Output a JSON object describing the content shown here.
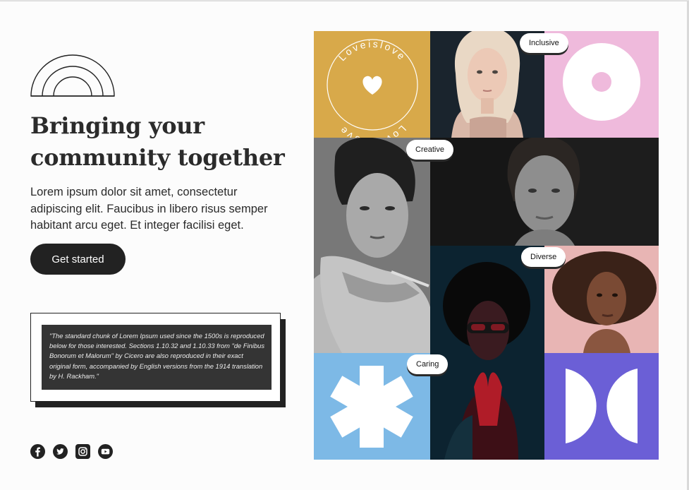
{
  "hero": {
    "headline_line1": "Bringing your",
    "headline_line2": "community together",
    "lead": "Lorem ipsum dolor sit amet, consectetur adipiscing elit. Faucibus in libero risus semper habitant arcu eget. Et integer facilisi eget.",
    "cta_label": "Get started"
  },
  "quote": {
    "text": "\"The standard chunk of Lorem Ipsum used since the 1500s is reproduced below for those interested. Sections 1.10.32 and 1.10.33 from \"de Finibus Bonorum et Malorum\" by Cicero are also reproduced in their exact original form, accompanied by English versions from the 1914 translation by H. Rackham.\""
  },
  "social": [
    {
      "icon": "facebook-icon"
    },
    {
      "icon": "twitter-icon"
    },
    {
      "icon": "instagram-icon"
    },
    {
      "icon": "youtube-icon"
    }
  ],
  "gallery": {
    "seal_text_top": "Loveislove",
    "seal_text_bottom": "Loveislove",
    "badges": {
      "inclusive": "Inclusive",
      "creative": "Creative",
      "diverse": "Diverse",
      "caring": "Caring"
    },
    "colors": {
      "mustard": "#d8a94a",
      "pink": "#efbadc",
      "blue": "#7db9e6",
      "purple": "#6b5fd6",
      "dark": "#222222"
    }
  }
}
